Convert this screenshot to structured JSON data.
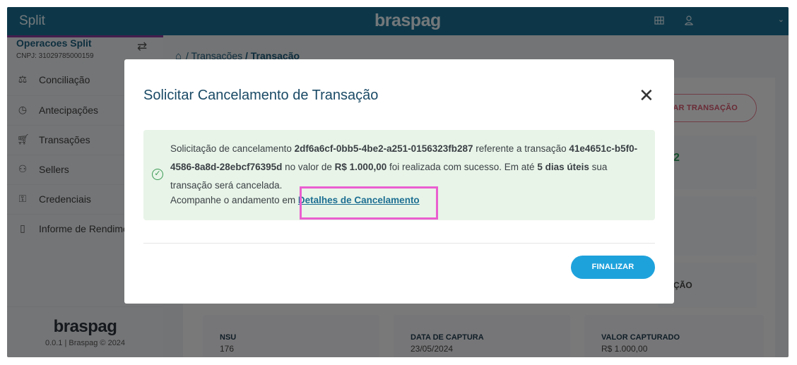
{
  "topbar": {
    "app_title": "Split",
    "logo": "braspag",
    "grid_icon": "grid-icon",
    "user_icon": "user-icon",
    "chevron": "⌄"
  },
  "sidebar": {
    "org_name": "Operacoes Split",
    "cnpj": "CNPJ: 31029785000159",
    "items": [
      {
        "label": "Conciliação",
        "icon": "reconcile-icon"
      },
      {
        "label": "Antecipações",
        "icon": "clock-icon"
      },
      {
        "label": "Transações",
        "icon": "cart-icon"
      },
      {
        "label": "Sellers",
        "icon": "users-icon"
      },
      {
        "label": "Credenciais",
        "icon": "key-icon"
      },
      {
        "label": "Informe de Rendime",
        "icon": "document-icon"
      }
    ],
    "footer_logo": "braspag",
    "version": "0.0.1 | Braspag © 2024"
  },
  "breadcrumb": {
    "transacoes": "Transações",
    "current": "Transação"
  },
  "background": {
    "cancel_button": "AR TRANSAÇÃO",
    "card_value": "2",
    "card_action": "ÇÃO",
    "info": [
      {
        "label": "NSU",
        "value": "176"
      },
      {
        "label": "DATA DE CAPTURA",
        "value": "23/05/2024"
      },
      {
        "label": "VALOR CAPTURADO",
        "value": "R$ 1.000,00"
      }
    ]
  },
  "modal": {
    "title": "Solicitar Cancelamento de Transação",
    "message": {
      "p1": "Solicitação de cancelamento ",
      "request_id": "2df6a6cf-0bb5-4be2-a251-0156323fb287",
      "p2": " referente a transação ",
      "transaction_id": "41e4651c-b5f0-4586-8a8d-28ebcf76395d",
      "p3": " no valor de ",
      "amount": "R$ 1.000,00",
      "p4": " foi realizada com sucesso. Em até ",
      "deadline": "5 dias úteis",
      "p5": " sua transação será cancelada."
    },
    "follow_text": "Acompanhe o andamento em ",
    "follow_link": "Detalhes de Cancelamento",
    "finalize_button": "FINALIZAR"
  },
  "colors": {
    "topbar": "#1b6f93",
    "accent_purple": "#8a3b9c",
    "success_bg": "#e8f4e8",
    "primary_button": "#1ea2dc",
    "highlight": "#ea5fcf"
  }
}
